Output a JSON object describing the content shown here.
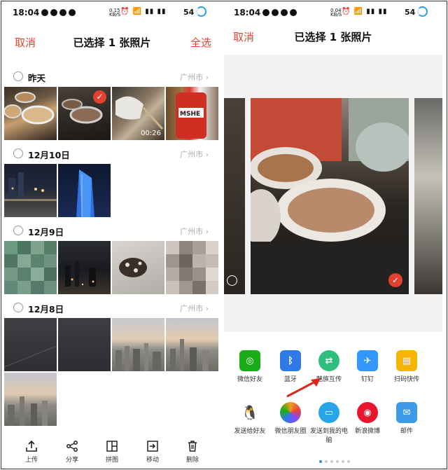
{
  "left": {
    "status": {
      "time": "18:04",
      "net_top": "0.15",
      "net_bottom": "KB/S",
      "battery": "54"
    },
    "header": {
      "cancel": "取消",
      "title": "已选择 1 张照片",
      "select_all": "全选"
    },
    "groups": [
      {
        "date": "昨天",
        "location": "广州市 ›"
      },
      {
        "date": "12月10日",
        "location": "广州市 ›"
      },
      {
        "date": "12月9日",
        "location": "广州市 ›"
      },
      {
        "date": "12月8日",
        "location": "广州市 ›"
      }
    ],
    "video_duration": "00:26",
    "selected_mark": "✓",
    "toolbar": [
      {
        "label": "上传",
        "icon": "upload-icon"
      },
      {
        "label": "分享",
        "icon": "share-icon"
      },
      {
        "label": "拼图",
        "icon": "collage-icon"
      },
      {
        "label": "移动",
        "icon": "move-icon"
      },
      {
        "label": "删除",
        "icon": "delete-icon"
      }
    ]
  },
  "right": {
    "status": {
      "time": "18:04",
      "net_top": "0.04",
      "net_bottom": "KB/S",
      "battery": "54"
    },
    "header": {
      "cancel": "取消",
      "title": "已选择 1 张照片"
    },
    "selected_mark": "✓",
    "share_targets": [
      {
        "label": "微信好友",
        "icon": "wechat-icon",
        "color": "#1aad19"
      },
      {
        "label": "蓝牙",
        "icon": "bluetooth-icon",
        "color": "#2f7ae5"
      },
      {
        "label": "魅族互传",
        "icon": "meizu-transfer-icon",
        "color": "#2fbf7d"
      },
      {
        "label": "钉钉",
        "icon": "dingtalk-icon",
        "color": "#3296fa"
      },
      {
        "label": "扫码快传",
        "icon": "scan-transfer-icon",
        "color": "#f5b400"
      },
      {
        "label": "发送给好友",
        "icon": "qq-icon",
        "color": "#111111"
      },
      {
        "label": "微信朋友圈",
        "icon": "moments-icon",
        "color": "#f29c1f"
      },
      {
        "label": "发送到我的电脑",
        "icon": "computer-icon",
        "color": "#27a5e8"
      },
      {
        "label": "新浪微博",
        "icon": "weibo-icon",
        "color": "#e6162d"
      },
      {
        "label": "邮件",
        "icon": "mail-icon",
        "color": "#3d9be9"
      }
    ]
  }
}
